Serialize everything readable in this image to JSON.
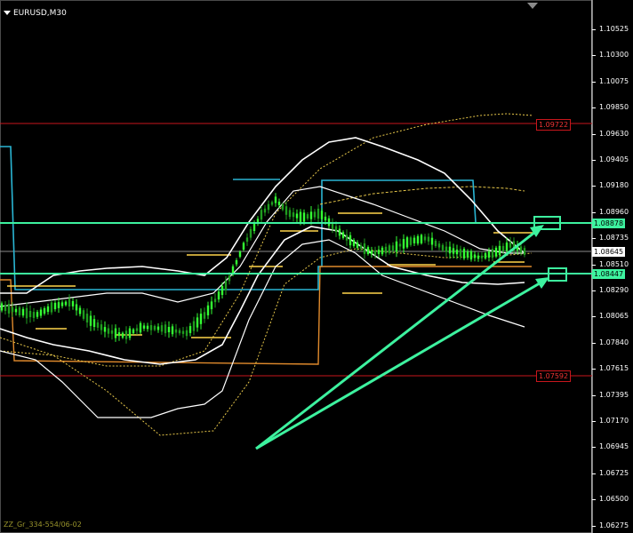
{
  "window": {
    "symbol_title": "EURUSD,M30"
  },
  "price_axis": {
    "ticks": [
      "1.10525",
      "1.10300",
      "1.10075",
      "1.09850",
      "1.09630",
      "1.09405",
      "1.09180",
      "1.08960",
      "1.08735",
      "1.08510",
      "1.08290",
      "1.08065",
      "1.07840",
      "1.07615",
      "1.07395",
      "1.07170",
      "1.06945",
      "1.06725",
      "1.06500",
      "1.06275"
    ],
    "current_price": "1.08645"
  },
  "price_levels": {
    "resistance": "1.09722",
    "upper_channel": "1.08878",
    "lower_channel": "1.08447",
    "support": "1.07592"
  },
  "watermark": "ZZ_Gr_334-554/06-02",
  "colors": {
    "background": "#000000",
    "bull_candle": "#33ff33",
    "bear_candle": "#1f9e1f",
    "bands": "#ffffff",
    "ma_dotted": "#e8c84a",
    "resistance_line": "#c8161c",
    "channel_line": "#3df29f",
    "donchian": "#2ab6d4",
    "pivot": "#ffd64a",
    "orange_level": "#e08a2c"
  }
}
